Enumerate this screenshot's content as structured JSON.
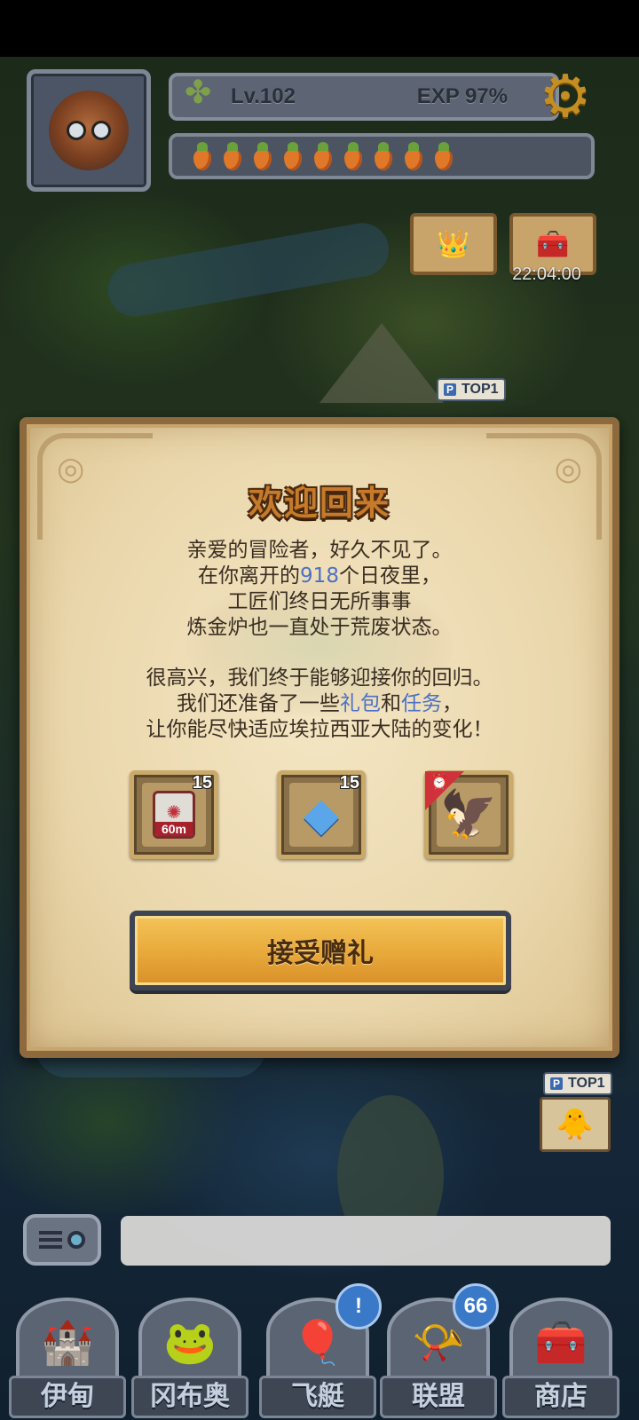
{
  "hud": {
    "level": "Lv.102",
    "exp": "EXP 97%",
    "carrot_count": 9,
    "event_timer": "22:04:00",
    "top_badge": "TOP1",
    "top_badge_tag": "P"
  },
  "dialog": {
    "title": "欢迎回来",
    "paragraph1": {
      "line1": "亲爱的冒险者，好久不见了。",
      "line2_pre": "在你离开的",
      "line2_days": "918",
      "line2_post": "个日夜里，",
      "line3": "工匠们终日无所事事",
      "line4": "炼金炉也一直处于荒废状态。"
    },
    "paragraph2": {
      "line1": "很高兴，我们终于能够迎接你的回归。",
      "line2_pre": "我们还准备了一些",
      "line2_gift": "礼包",
      "line2_and": "和",
      "line2_task": "任务",
      "line2_post": "，",
      "line3": "让你能尽快适应埃拉西亚大陆的变化！"
    },
    "rewards": [
      {
        "name": "speedup-60m",
        "label": "60m",
        "count": "15",
        "icon": "speedup-icon"
      },
      {
        "name": "blue-crystal",
        "count": "15",
        "icon": "crystal-icon"
      },
      {
        "name": "pet-creature",
        "icon": "pet-icon",
        "ribbon": "timed"
      }
    ],
    "accept_button": "接受赠礼"
  },
  "nav": [
    {
      "label": "伊甸",
      "icon": "eden-icon"
    },
    {
      "label": "冈布奥",
      "icon": "gumball-icon"
    },
    {
      "label": "飞艇",
      "icon": "airship-icon",
      "badge": "!"
    },
    {
      "label": "联盟",
      "icon": "alliance-icon",
      "badge": "66"
    },
    {
      "label": "商店",
      "icon": "shop-icon"
    }
  ],
  "colors": {
    "highlight": "#4b70c6",
    "title": "#c67a2a",
    "button": "#e8a83a",
    "badge": "#3a78c8"
  }
}
